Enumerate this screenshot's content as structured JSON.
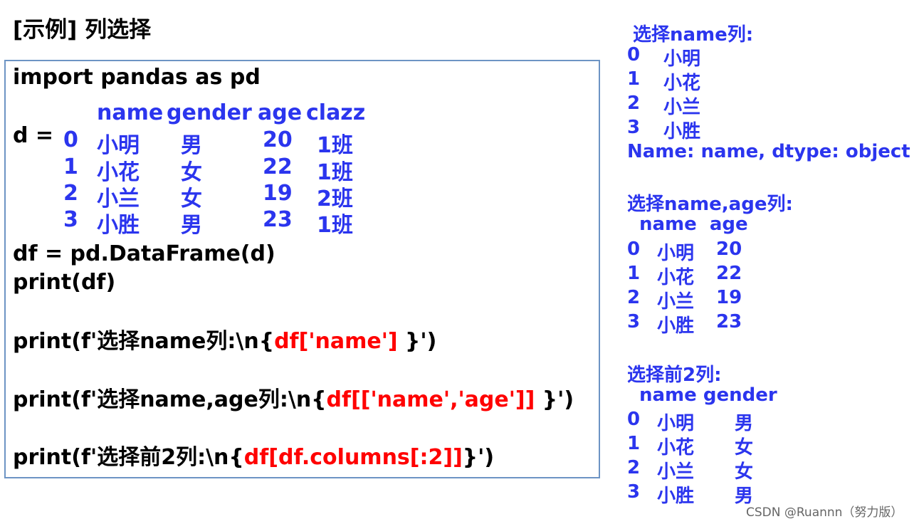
{
  "title": "[示例] 列选择",
  "code": {
    "import_line": "import pandas as pd",
    "d_label": "d =",
    "d_table": {
      "columns": [
        "name",
        "gender",
        "age",
        "clazz"
      ],
      "rows": [
        {
          "index": "0",
          "name": "小明",
          "gender": "男",
          "age": "20",
          "clazz": "1班"
        },
        {
          "index": "1",
          "name": "小花",
          "gender": "女",
          "age": "22",
          "clazz": "1班"
        },
        {
          "index": "2",
          "name": "小兰",
          "gender": "女",
          "age": "19",
          "clazz": "2班"
        },
        {
          "index": "3",
          "name": "小胜",
          "gender": "男",
          "age": "23",
          "clazz": "1班"
        }
      ]
    },
    "df_line": "df = pd.DataFrame(d)",
    "print_df": "print(df)",
    "print1": {
      "prefix": "print(f'选择name列:\\n{",
      "expr": "df['name']",
      "suffix": " }')"
    },
    "print2": {
      "prefix": "print(f'选择name,age列:\\n{",
      "expr": "df[['name','age']]",
      "suffix": " }')"
    },
    "print3": {
      "prefix": "print(f'选择前2列:\\n{",
      "expr": "df[df.columns[:2]]",
      "suffix": "}')"
    }
  },
  "output": {
    "block1": {
      "title": "选择name列:",
      "rows": [
        {
          "index": "0",
          "name": "小明"
        },
        {
          "index": "1",
          "name": "小花"
        },
        {
          "index": "2",
          "name": "小兰"
        },
        {
          "index": "3",
          "name": "小胜"
        }
      ],
      "footer": "Name: name, dtype: object"
    },
    "block2": {
      "title": "选择name,age列:",
      "header": "name  age",
      "rows": [
        {
          "index": "0",
          "name": "小明",
          "age": "20"
        },
        {
          "index": "1",
          "name": "小花",
          "age": "22"
        },
        {
          "index": "2",
          "name": "小兰",
          "age": "19"
        },
        {
          "index": "3",
          "name": "小胜",
          "age": "23"
        }
      ]
    },
    "block3": {
      "title": "选择前2列:",
      "header": "name gender",
      "rows": [
        {
          "index": "0",
          "name": "小明",
          "gender": "男"
        },
        {
          "index": "1",
          "name": "小花",
          "gender": "女"
        },
        {
          "index": "2",
          "name": "小兰",
          "gender": "女"
        },
        {
          "index": "3",
          "name": "小胜",
          "gender": "男"
        }
      ]
    }
  },
  "watermark": "CSDN @Ruannn（努力版）",
  "colors": {
    "code_text": "#000000",
    "highlight": "#ff0000",
    "output": "#2b35ee",
    "box_border": "#6d94c4"
  }
}
